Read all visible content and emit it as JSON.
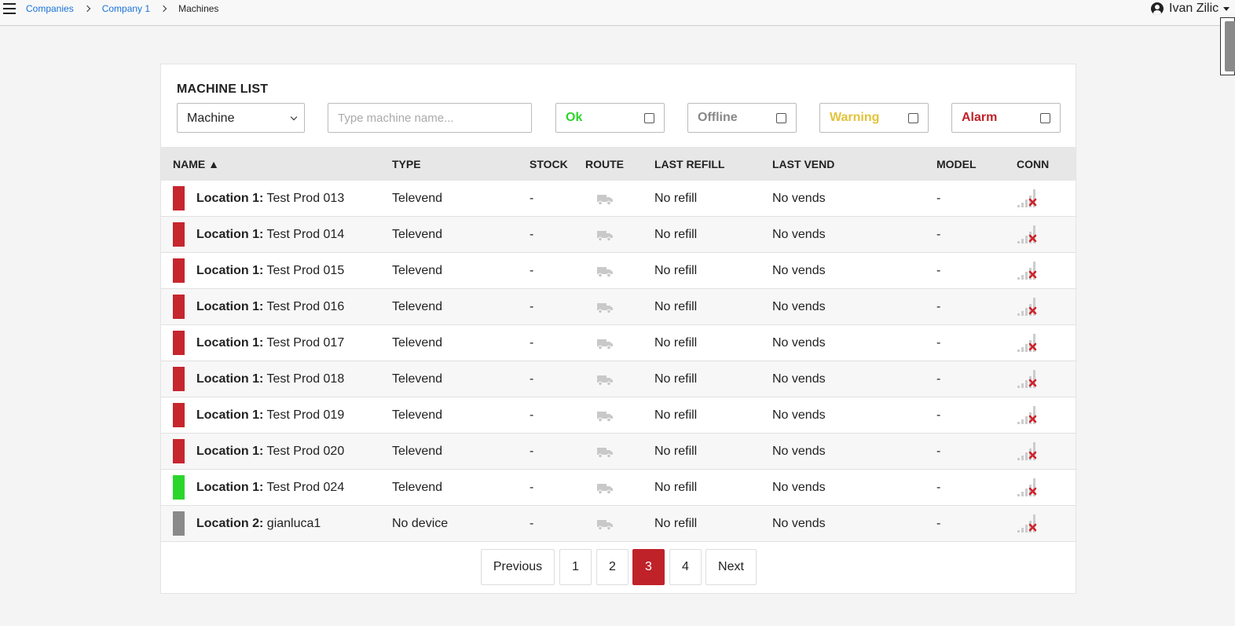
{
  "topbar": {
    "breadcrumbs": [
      "Companies",
      "Company 1",
      "Machines"
    ],
    "user_name": "Ivan Zilic"
  },
  "card": {
    "title": "MACHINE LIST",
    "filter_select_value": "Machine",
    "search_placeholder": "Type machine name...",
    "status_filters": [
      {
        "label": "Ok",
        "color": "#2bd62b",
        "checked": false
      },
      {
        "label": "Offline",
        "color": "#888888",
        "checked": false
      },
      {
        "label": "Warning",
        "color": "#e3c33a",
        "checked": false
      },
      {
        "label": "Alarm",
        "color": "#c0222a",
        "checked": false
      }
    ]
  },
  "table": {
    "columns": [
      "NAME ▲",
      "TYPE",
      "STOCK",
      "ROUTE",
      "LAST REFILL",
      "LAST VEND",
      "MODEL",
      "CONN"
    ],
    "rows": [
      {
        "status_color": "#c6262e",
        "location": "Location 1:",
        "name": "Test Prod 013",
        "type": "Televend",
        "stock": "-",
        "last_refill": "No refill",
        "last_vend": "No vends",
        "model": "-"
      },
      {
        "status_color": "#c6262e",
        "location": "Location 1:",
        "name": "Test Prod 014",
        "type": "Televend",
        "stock": "-",
        "last_refill": "No refill",
        "last_vend": "No vends",
        "model": "-"
      },
      {
        "status_color": "#c6262e",
        "location": "Location 1:",
        "name": "Test Prod 015",
        "type": "Televend",
        "stock": "-",
        "last_refill": "No refill",
        "last_vend": "No vends",
        "model": "-"
      },
      {
        "status_color": "#c6262e",
        "location": "Location 1:",
        "name": "Test Prod 016",
        "type": "Televend",
        "stock": "-",
        "last_refill": "No refill",
        "last_vend": "No vends",
        "model": "-"
      },
      {
        "status_color": "#c6262e",
        "location": "Location 1:",
        "name": "Test Prod 017",
        "type": "Televend",
        "stock": "-",
        "last_refill": "No refill",
        "last_vend": "No vends",
        "model": "-"
      },
      {
        "status_color": "#c6262e",
        "location": "Location 1:",
        "name": "Test Prod 018",
        "type": "Televend",
        "stock": "-",
        "last_refill": "No refill",
        "last_vend": "No vends",
        "model": "-"
      },
      {
        "status_color": "#c6262e",
        "location": "Location 1:",
        "name": "Test Prod 019",
        "type": "Televend",
        "stock": "-",
        "last_refill": "No refill",
        "last_vend": "No vends",
        "model": "-"
      },
      {
        "status_color": "#c6262e",
        "location": "Location 1:",
        "name": "Test Prod 020",
        "type": "Televend",
        "stock": "-",
        "last_refill": "No refill",
        "last_vend": "No vends",
        "model": "-"
      },
      {
        "status_color": "#2bd62b",
        "location": "Location 1:",
        "name": "Test Prod 024",
        "type": "Televend",
        "stock": "-",
        "last_refill": "No refill",
        "last_vend": "No vends",
        "model": "-"
      },
      {
        "status_color": "#8a8a8a",
        "location": "Location 2:",
        "name": "gianluca1",
        "type": "No device",
        "stock": "-",
        "last_refill": "No refill",
        "last_vend": "No vends",
        "model": "-"
      }
    ]
  },
  "pagination": {
    "previous": "Previous",
    "pages": [
      "1",
      "2",
      "3",
      "4"
    ],
    "current": "3",
    "next": "Next"
  }
}
